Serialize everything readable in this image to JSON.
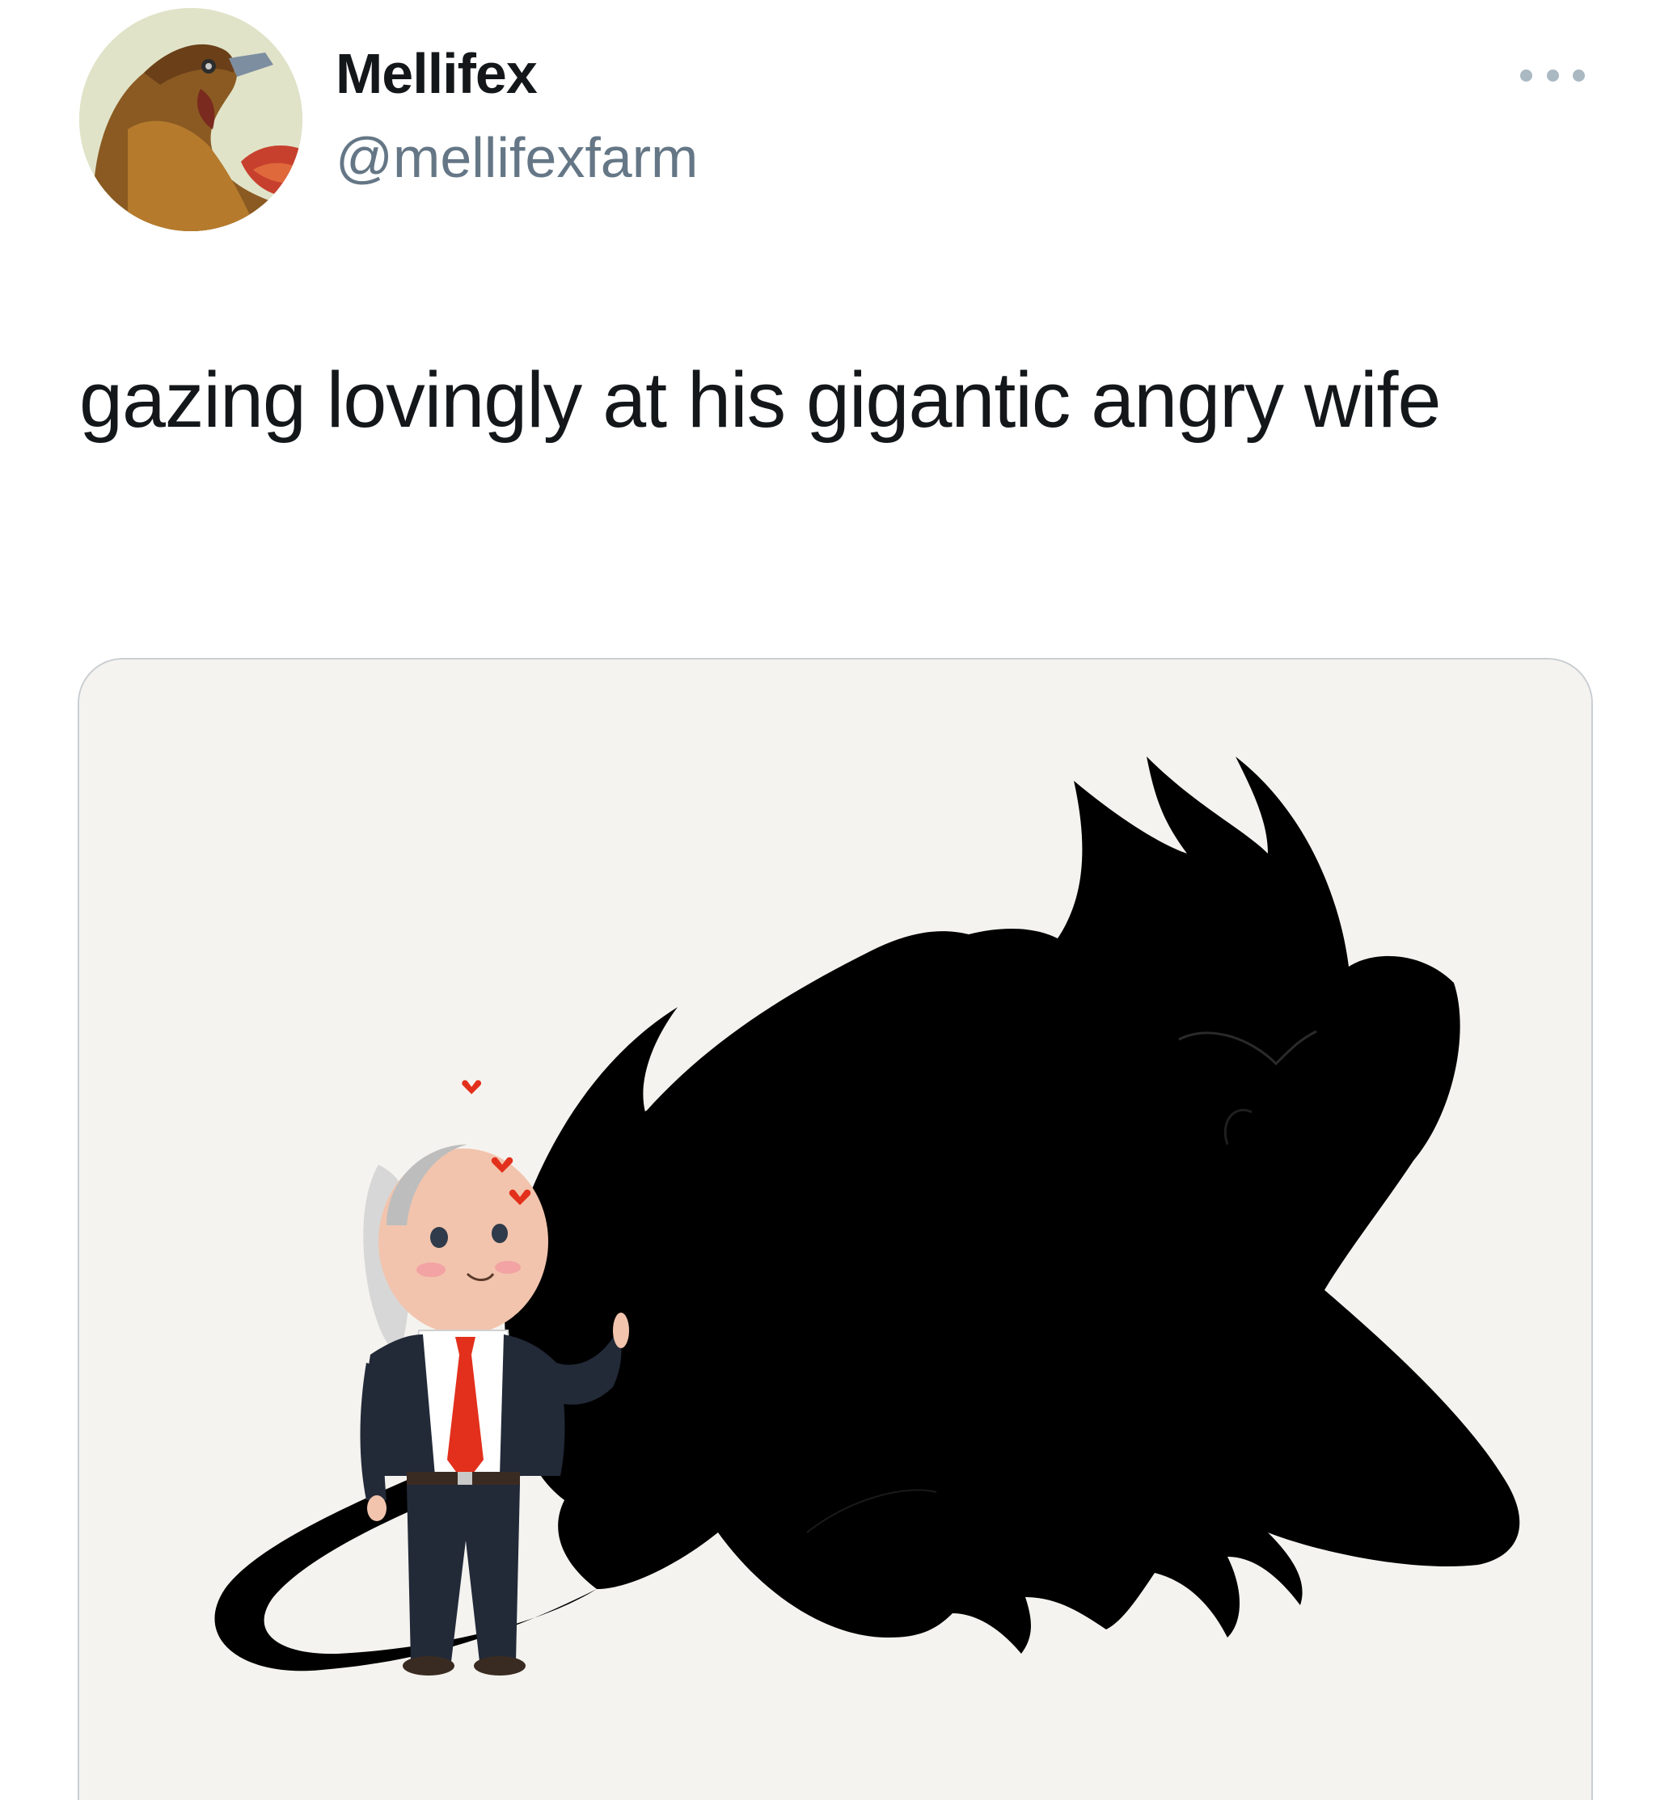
{
  "tweet": {
    "author": {
      "display_name": "Mellifex",
      "handle": "@mellifexfarm",
      "avatar": "chicken-avatar"
    },
    "more_icon": "ellipsis-icon",
    "text": "gazing lovingly at his gigantic angry wife",
    "media": {
      "type": "illustration"
    }
  }
}
